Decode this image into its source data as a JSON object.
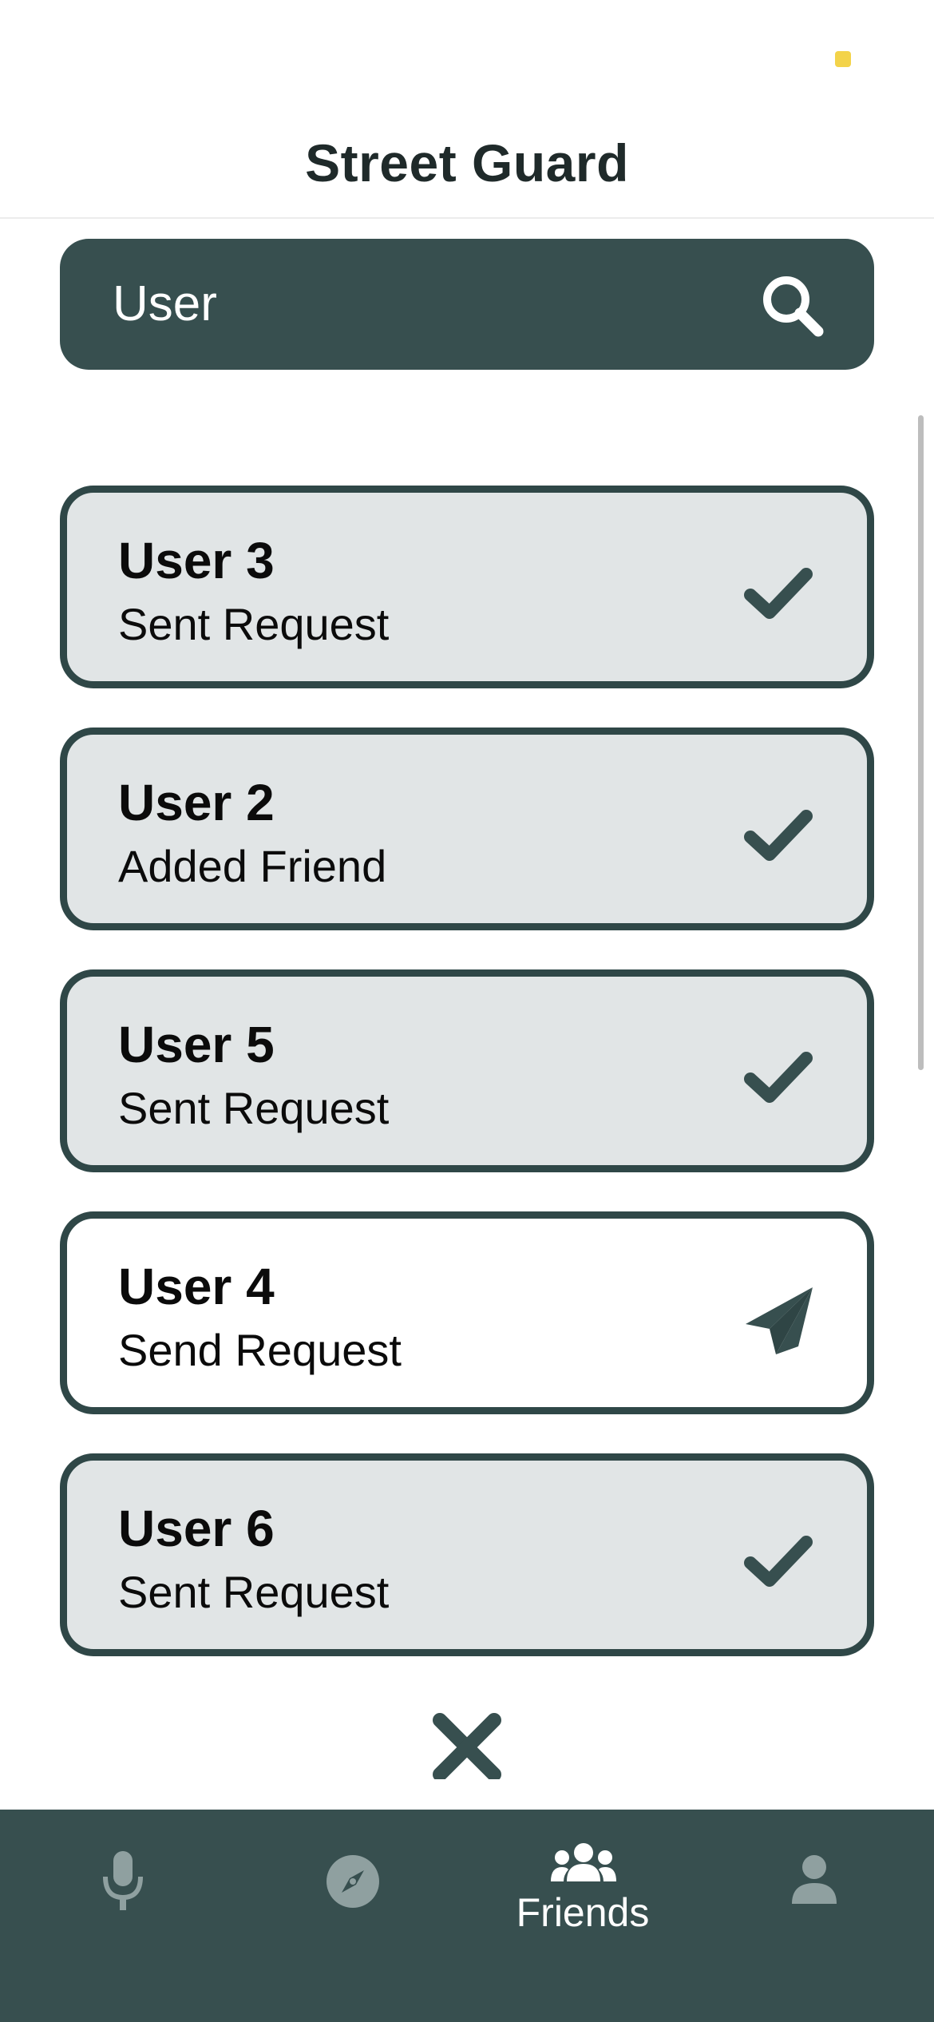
{
  "app": {
    "title": "Street Guard"
  },
  "search": {
    "placeholder": "User",
    "value": ""
  },
  "users": [
    {
      "name": "User 3",
      "status": "Sent Request",
      "icon": "check-icon"
    },
    {
      "name": "User 2",
      "status": "Added Friend",
      "icon": "check-icon"
    },
    {
      "name": "User 5",
      "status": "Sent Request",
      "icon": "check-icon"
    },
    {
      "name": "User 4",
      "status": "Send Request",
      "icon": "send-icon"
    },
    {
      "name": "User 6",
      "status": "Sent Request",
      "icon": "check-icon"
    }
  ],
  "tabs": [
    {
      "id": "microphone",
      "icon": "microphone-icon",
      "label": ""
    },
    {
      "id": "explore",
      "icon": "compass-icon",
      "label": ""
    },
    {
      "id": "friends",
      "icon": "friends-icon",
      "label": "Friends",
      "active": true
    },
    {
      "id": "profile",
      "icon": "user-icon",
      "label": ""
    }
  ],
  "colors": {
    "primary": "#374f4f",
    "card_border": "#2f4747",
    "card_sent": "#e1e5e6",
    "card_pending": "#ffffff",
    "tab_inactive_icon": "#8fa0a0"
  }
}
